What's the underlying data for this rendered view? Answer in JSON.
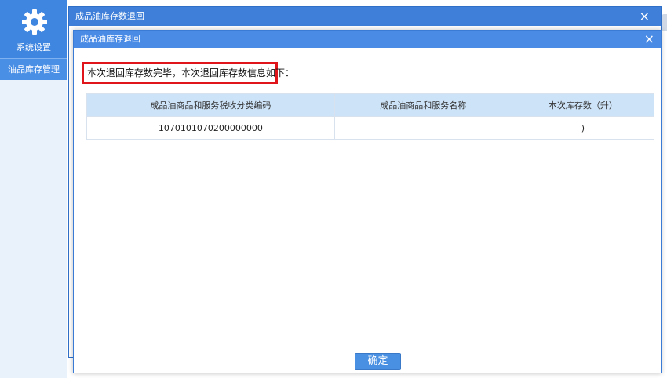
{
  "sidebar": {
    "top_icon": "gear-icon",
    "top_label": "系统设置",
    "items": [
      {
        "label": "油品库存管理"
      }
    ]
  },
  "outer_window": {
    "title": "成品油库存数退回",
    "close_glyph": "×"
  },
  "dialog": {
    "title": "成品油库存退回",
    "close_glyph": "×",
    "message": "本次退回库存数完毕，本次退回库存数信息如下：",
    "table": {
      "headers": [
        "成品油商品和服务税收分类编码",
        "成品油商品和服务名称",
        "本次库存数（升）"
      ],
      "rows": [
        [
          "1070101070200000000",
          "",
          ")"
        ]
      ]
    },
    "confirm_label": "确定"
  },
  "colors": {
    "accent": "#3f86e0",
    "titlebar": "#4a8be6",
    "highlight_border": "#e0151b",
    "table_header": "#cde3f7"
  }
}
